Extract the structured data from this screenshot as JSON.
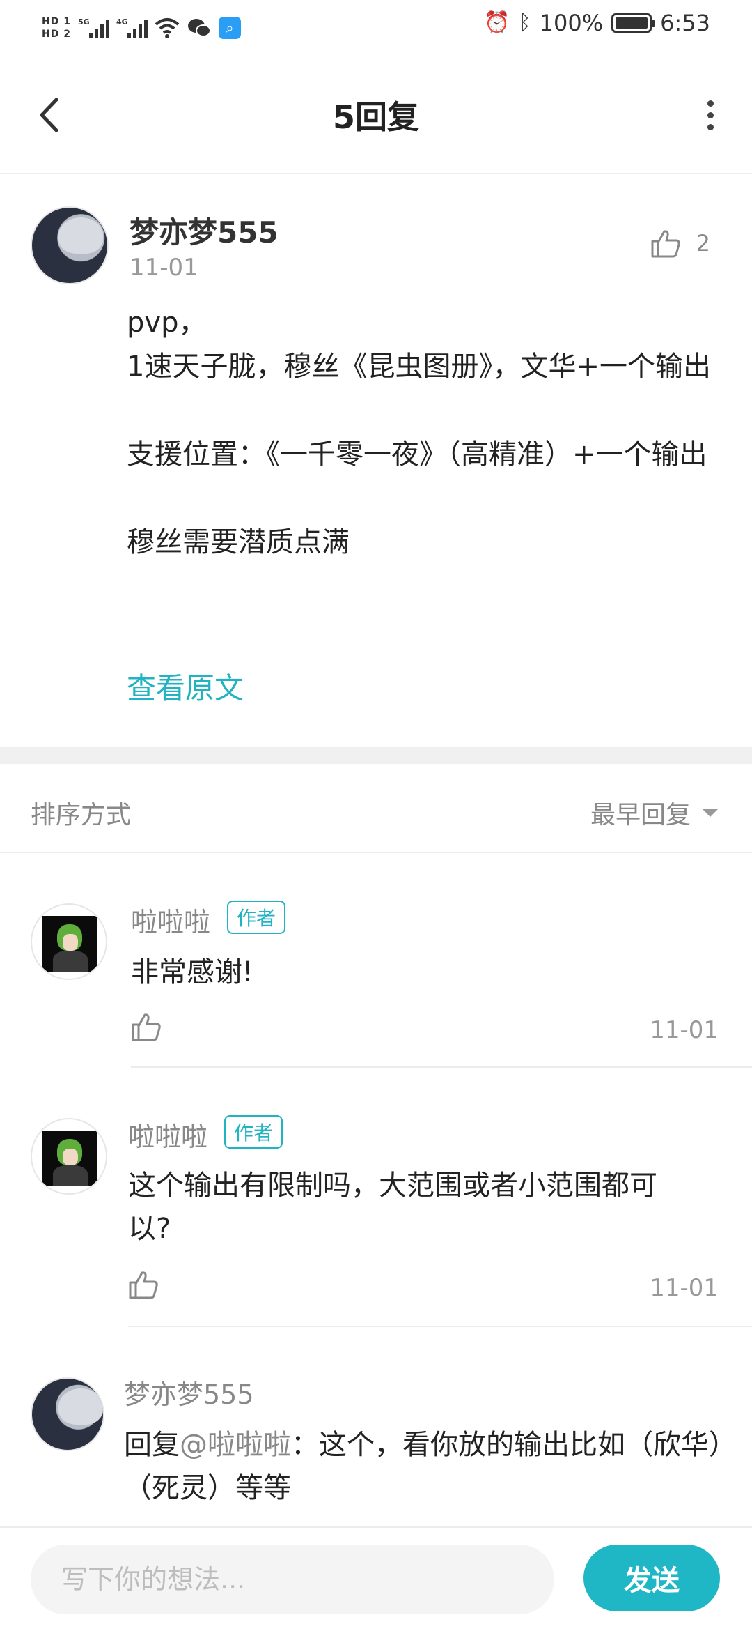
{
  "status_bar": {
    "hd1": "HD 1",
    "hd2": "HD 2",
    "net1": "5G",
    "net2": "4G",
    "battery_text": "100%",
    "time": "6:53",
    "icons": [
      "signal-icon",
      "wifi-icon",
      "wechat-icon",
      "search-app-icon",
      "alarm-icon",
      "bluetooth-icon",
      "battery-icon"
    ]
  },
  "header": {
    "title": "5回复",
    "icons": [
      "back-arrow-icon",
      "more-dots-icon"
    ]
  },
  "post": {
    "author": "梦亦梦555",
    "date": "11-01",
    "like_count": "2",
    "lines": [
      "pvp，",
      "1速天子胧，穆丝《昆虫图册》，文华+一个输出",
      "",
      "支援位置：《一千零一夜》（高精准）+一个输出",
      "",
      "穆丝需要潜质点满"
    ],
    "view_original": "查看原文"
  },
  "sort": {
    "label": "排序方式",
    "selected": "最早回复"
  },
  "replies": [
    {
      "name": "啦啦啦",
      "badge": "作者",
      "text": "非常感谢!",
      "date": "11-01"
    },
    {
      "name": "啦啦啦",
      "badge": "作者",
      "text": "这个输出有限制吗，大范围或者小范围都可以?",
      "date": "11-01"
    },
    {
      "name": "梦亦梦555",
      "reply_prefix": "回复",
      "mention": "@啦啦啦",
      "reply_body": "：这个，看你放的输出比如（欣华）（死灵）等等"
    }
  ],
  "composer": {
    "placeholder": "写下你的想法...",
    "send_label": "发送"
  },
  "colors": {
    "accent": "#1fb6c6",
    "text_muted": "#888888"
  }
}
